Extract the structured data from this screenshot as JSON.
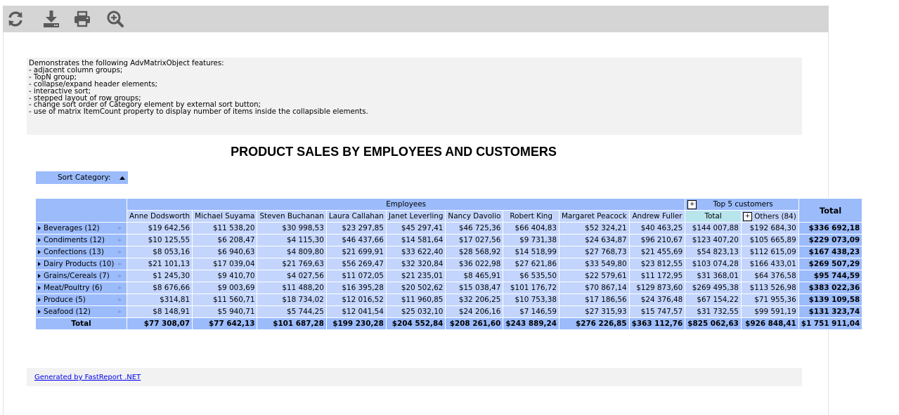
{
  "toolbar": {
    "buttons": [
      {
        "name": "refresh-icon"
      },
      {
        "name": "download-icon"
      },
      {
        "name": "print-icon"
      },
      {
        "name": "zoom-in-icon"
      }
    ],
    "color": "#d5d5d5"
  },
  "description": {
    "lines": [
      "Demonstrates the following AdvMatrixObject features:",
      "- adjacent column groups;",
      "- TopN group;",
      "- collapse/expand header elements;",
      "- interactive sort;",
      "- stepped layout of row groups;",
      "- change sort order of Category element by external sort button;",
      "- use of matrix ItemCount property to display number of items inside the collapsible elements."
    ]
  },
  "report": {
    "title": "PRODUCT SALES BY EMPLOYEES AND CUSTOMERS",
    "sort_button_label": "Sort Category:"
  },
  "matrix": {
    "group_employees": "Employees",
    "group_top5": "Top 5 customers",
    "plus": "+",
    "total_header": "Total",
    "employees": [
      "Anne Dodsworth",
      "Michael Suyama",
      "Steven Buchanan",
      "Laura Callahan",
      "Janet Leverling",
      "Nancy Davolio",
      "Robert King",
      "Margaret Peacock",
      "Andrew Fuller"
    ],
    "top5_total_label": "Total",
    "others_label": "Others (84)",
    "sort_glyph": "≑",
    "rows": [
      {
        "category": "Beverages (12)",
        "values": [
          "$19 642,56",
          "$11 538,20",
          "$30 998,53",
          "$23 297,85",
          "$45 297,41",
          "$46 725,36",
          "$66 404,83",
          "$52 324,21",
          "$40 463,25"
        ],
        "top5_total": "$144 007,88",
        "others": "$192 684,30",
        "total": "$336 692,18"
      },
      {
        "category": "Condiments (12)",
        "values": [
          "$10 125,55",
          "$6 208,47",
          "$4 115,30",
          "$46 437,66",
          "$14 581,64",
          "$17 027,56",
          "$9 731,38",
          "$24 634,87",
          "$96 210,67"
        ],
        "top5_total": "$123 407,20",
        "others": "$105 665,89",
        "total": "$229 073,09"
      },
      {
        "category": "Confections (13)",
        "values": [
          "$8 053,16",
          "$6 940,63",
          "$4 809,80",
          "$21 699,91",
          "$33 622,40",
          "$28 568,92",
          "$14 518,99",
          "$27 768,73",
          "$21 455,69"
        ],
        "top5_total": "$54 823,13",
        "others": "$112 615,09",
        "total": "$167 438,23"
      },
      {
        "category": "Dairy Products (10)",
        "values": [
          "$21 101,13",
          "$17 039,04",
          "$21 769,63",
          "$56 269,47",
          "$32 320,84",
          "$36 022,98",
          "$27 621,86",
          "$33 549,80",
          "$23 812,55"
        ],
        "top5_total": "$103 074,28",
        "others": "$166 433,01",
        "total": "$269 507,29"
      },
      {
        "category": "Grains/Cereals (7)",
        "values": [
          "$1 245,30",
          "$9 410,70",
          "$4 027,56",
          "$11 072,05",
          "$21 235,01",
          "$8 465,91",
          "$6 535,50",
          "$22 579,61",
          "$11 172,95"
        ],
        "top5_total": "$31 368,01",
        "others": "$64 376,58",
        "total": "$95 744,59"
      },
      {
        "category": "Meat/Poultry (6)",
        "values": [
          "$8 676,66",
          "$9 003,69",
          "$11 488,20",
          "$16 395,28",
          "$20 502,62",
          "$15 038,47",
          "$101 176,72",
          "$70 867,14",
          "$129 873,60"
        ],
        "top5_total": "$269 495,38",
        "others": "$113 526,98",
        "total": "$383 022,36"
      },
      {
        "category": "Produce (5)",
        "values": [
          "$314,81",
          "$11 560,71",
          "$18 734,02",
          "$12 016,52",
          "$11 960,85",
          "$32 206,25",
          "$10 753,38",
          "$17 186,56",
          "$24 376,48"
        ],
        "top5_total": "$67 154,22",
        "others": "$71 955,36",
        "total": "$139 109,58"
      },
      {
        "category": "Seafood (12)",
        "values": [
          "$8 148,91",
          "$5 940,71",
          "$5 744,25",
          "$12 041,54",
          "$25 032,10",
          "$24 206,16",
          "$7 146,59",
          "$27 315,93",
          "$15 747,57"
        ],
        "top5_total": "$31 732,55",
        "others": "$99 591,19",
        "total": "$131 323,74"
      }
    ],
    "totals": {
      "label": "Total",
      "values": [
        "$77 308,07",
        "$77 642,13",
        "$101 687,28",
        "$199 230,28",
        "$204 552,84",
        "$208 261,60",
        "$243 889,24",
        "$276 226,85",
        "$363 112,76"
      ],
      "top5_total": "$825 062,63",
      "others": "$926 848,41",
      "total": "$1 751 911,04"
    }
  },
  "footer": {
    "link_text": "Generated by FastReport .NET"
  }
}
